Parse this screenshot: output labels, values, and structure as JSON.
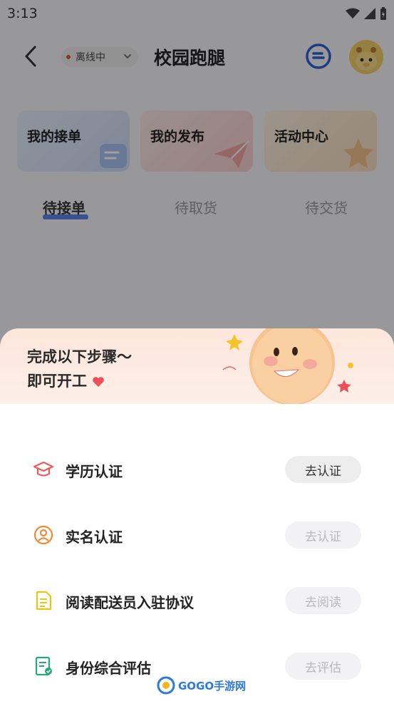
{
  "status_bar": {
    "time": "3:13"
  },
  "header": {
    "status_pill": "离线中",
    "title": "校园跑腿"
  },
  "cards": [
    {
      "label": "我的接单",
      "accent": "#3f6ee8"
    },
    {
      "label": "我的发布",
      "accent": "#e0604a"
    },
    {
      "label": "活动中心",
      "accent": "#e08a3a"
    }
  ],
  "tabs": [
    {
      "label": "待接单",
      "active": true
    },
    {
      "label": "待取货",
      "active": false
    },
    {
      "label": "待交货",
      "active": false
    }
  ],
  "sheet": {
    "banner_line1": "完成以下步骤～",
    "banner_line2": "即可开工",
    "steps": [
      {
        "label": "学历认证",
        "button": "去认证",
        "enabled": true,
        "icon": "graduation-cap-icon"
      },
      {
        "label": "实名认证",
        "button": "去认证",
        "enabled": false,
        "icon": "user-circle-icon"
      },
      {
        "label": "阅读配送员入驻协议",
        "button": "去阅读",
        "enabled": false,
        "icon": "document-icon"
      },
      {
        "label": "身份综合评估",
        "button": "去评估",
        "enabled": false,
        "icon": "evaluation-icon"
      }
    ]
  },
  "watermark": {
    "text": "GOGO手游网"
  }
}
